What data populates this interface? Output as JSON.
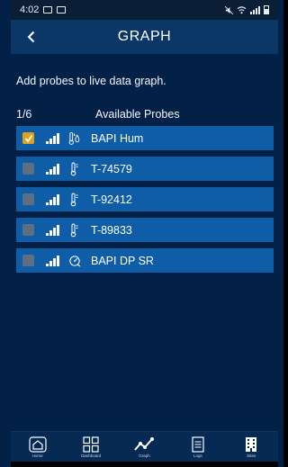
{
  "status_bar": {
    "time": "4:02"
  },
  "header": {
    "title": "GRAPH",
    "back_icon": "chevron-left-icon"
  },
  "intro_text": "Add probes to live data graph.",
  "list_header": {
    "count": "1/6",
    "title": "Available Probes"
  },
  "probes": [
    {
      "name": "BAPI Hum",
      "checked": true,
      "icon": "humidity-thermometer-icon"
    },
    {
      "name": "T-74579",
      "checked": false,
      "icon": "thermometer-icon"
    },
    {
      "name": "T-92412",
      "checked": false,
      "icon": "thermometer-icon"
    },
    {
      "name": "T-89833",
      "checked": false,
      "icon": "thermometer-icon"
    },
    {
      "name": "BAPI DP SR",
      "checked": false,
      "icon": "pressure-gauge-icon"
    }
  ],
  "nav": [
    {
      "label": "Home",
      "icon": "home-icon"
    },
    {
      "label": "Dashboard",
      "icon": "grid-icon"
    },
    {
      "label": "Graph",
      "icon": "graph-icon"
    },
    {
      "label": "Logs",
      "icon": "document-icon"
    },
    {
      "label": "Sites",
      "icon": "building-icon"
    }
  ],
  "colors": {
    "background": "#032146",
    "header": "#0a3766",
    "row": "#0f5da6",
    "checkbox_checked": "#e0a21d",
    "checkbox_unchecked": "#5f6f82"
  }
}
